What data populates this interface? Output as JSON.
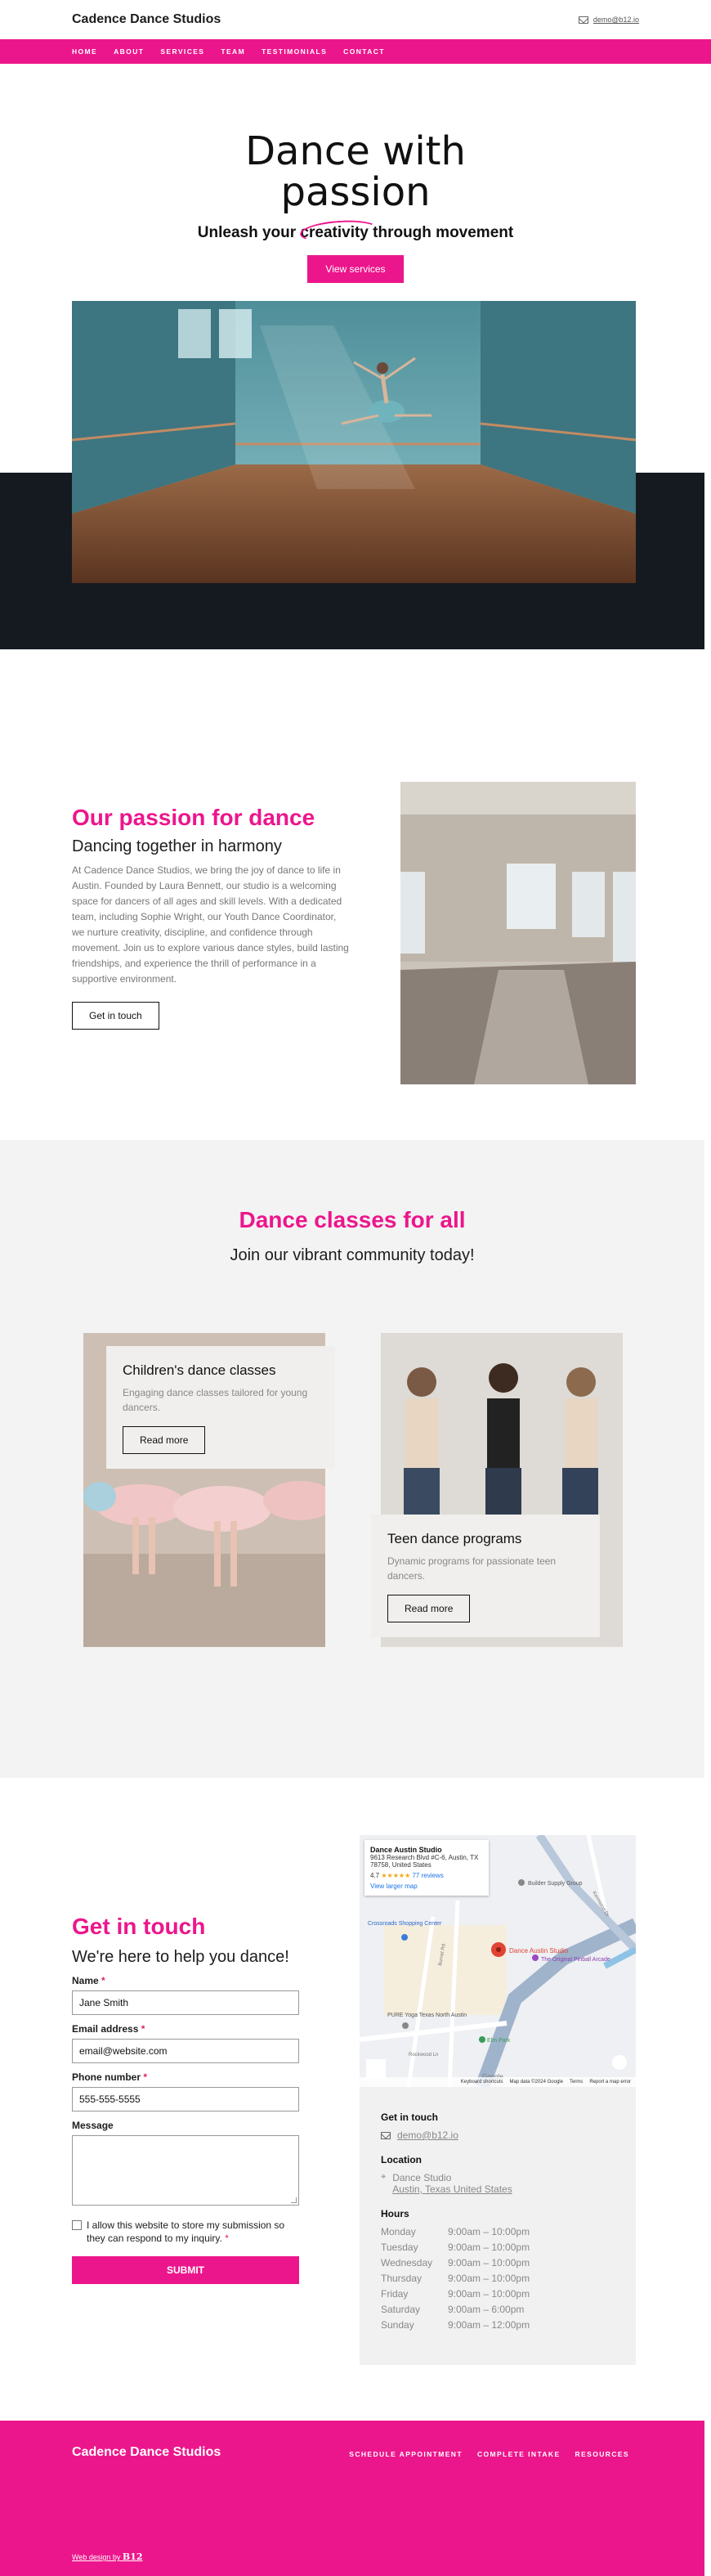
{
  "site": {
    "brand": "Cadence Dance Studios",
    "email": "demo@b12.io"
  },
  "nav": [
    "HOME",
    "ABOUT",
    "SERVICES",
    "TEAM",
    "TESTIMONIALS",
    "CONTACT"
  ],
  "hero": {
    "title_line1": "Dance with",
    "title_line2": "passion",
    "subtitle": "Unleash your creativity through movement",
    "cta": "View services"
  },
  "passion": {
    "title": "Our passion for dance",
    "subtitle": "Dancing together in harmony",
    "body": "At Cadence Dance Studios, we bring the joy of dance to life in Austin. Founded by Laura Bennett, our studio is a welcoming space for dancers of all ages and skill levels. With a dedicated team, including Sophie Wright, our Youth Dance Coordinator, we nurture creativity, discipline, and confidence through movement. Join us to explore various dance styles, build lasting friendships, and experience the thrill of performance in a supportive environment.",
    "cta": "Get in touch"
  },
  "classes": {
    "title": "Dance classes for all",
    "lead": "Join our vibrant community today!",
    "cards": [
      {
        "title": "Children's dance classes",
        "desc": "Engaging dance classes tailored for young dancers.",
        "cta": "Read more"
      },
      {
        "title": "Teen dance programs",
        "desc": "Dynamic programs for passionate teen dancers.",
        "cta": "Read more"
      }
    ]
  },
  "contact": {
    "title": "Get in touch",
    "lead": "We're here to help you dance!",
    "fields": {
      "name_label": "Name",
      "name_value": "Jane Smith",
      "email_label": "Email address",
      "email_value": "email@website.com",
      "phone_label": "Phone number",
      "phone_value": "555-555-5555",
      "message_label": "Message"
    },
    "required_mark": "*",
    "consent": "I allow this website to store my submission so they can respond to my inquiry.",
    "submit": "SUBMIT"
  },
  "map": {
    "place": "Dance Austin Studio",
    "address": "9613 Research Blvd #C-6, Austin, TX 78758, United States",
    "rating": "4.7",
    "stars": "★★★★★",
    "reviews": "77 reviews",
    "larger": "View larger map",
    "pin_label": "Dance Austin Studio",
    "labels": [
      "Builder Supply Group",
      "Crossroads Shopping Center",
      "The Original Pinball Arcade",
      "PURE Yoga Texas North Austin",
      "Elm Park",
      "Research Blvd",
      "Burnet Rd",
      "Rockwood Ln",
      "Kenniston Dr",
      "Mopac Expy",
      "Denson Dr"
    ],
    "footer": [
      "Keyboard shortcuts",
      "Map data ©2024 Google",
      "Terms",
      "Report a map error"
    ],
    "google": "Google"
  },
  "info": {
    "contact_h": "Get in touch",
    "email": "demo@b12.io",
    "location_h": "Location",
    "loc_name": "Dance Studio",
    "loc_addr": "Austin, Texas United States",
    "hours_h": "Hours",
    "hours": [
      {
        "day": "Monday",
        "time": "9:00am  –  10:00pm"
      },
      {
        "day": "Tuesday",
        "time": "9:00am  –  10:00pm"
      },
      {
        "day": "Wednesday",
        "time": "9:00am  –  10:00pm"
      },
      {
        "day": "Thursday",
        "time": "9:00am  –  10:00pm"
      },
      {
        "day": "Friday",
        "time": "9:00am  –  10:00pm"
      },
      {
        "day": "Saturday",
        "time": "9:00am  –  6:00pm"
      },
      {
        "day": "Sunday",
        "time": "9:00am  –  12:00pm"
      }
    ]
  },
  "footer": {
    "brand": "Cadence Dance Studios",
    "links": [
      "SCHEDULE APPOINTMENT",
      "COMPLETE INTAKE",
      "RESOURCES"
    ],
    "credit": "Web design by",
    "credit_logo": "B12"
  },
  "colors": {
    "accent": "#ec168c",
    "dark": "#151a21",
    "panel": "#f3f3f3"
  }
}
